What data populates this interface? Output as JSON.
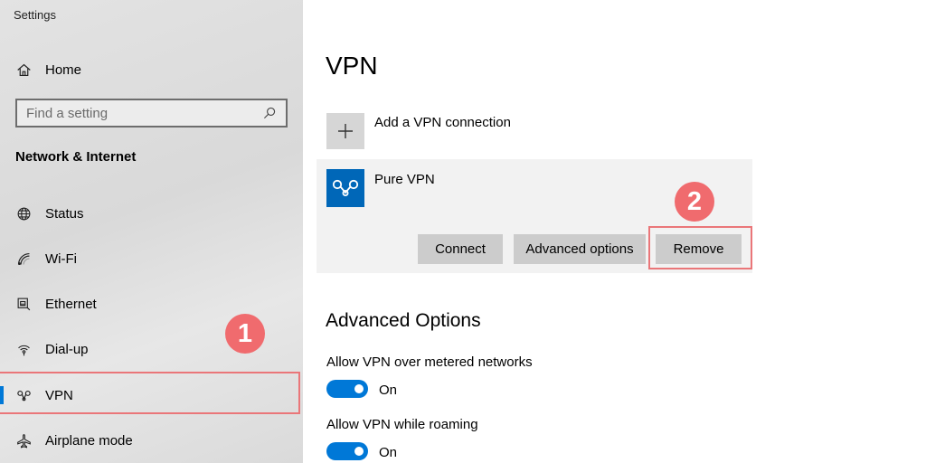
{
  "window": {
    "title": "Settings"
  },
  "sidebar": {
    "home_label": "Home",
    "search": {
      "placeholder": "Find a setting"
    },
    "section_title": "Network & Internet",
    "items": [
      {
        "label": "Status",
        "icon": "globe-icon"
      },
      {
        "label": "Wi-Fi",
        "icon": "wifi-icon"
      },
      {
        "label": "Ethernet",
        "icon": "ethernet-icon"
      },
      {
        "label": "Dial-up",
        "icon": "dial-up-icon"
      },
      {
        "label": "VPN",
        "icon": "vpn-icon",
        "selected": true
      },
      {
        "label": "Airplane mode",
        "icon": "airplane-icon"
      }
    ]
  },
  "main": {
    "title": "VPN",
    "add_connection_label": "Add a VPN connection",
    "connection": {
      "name": "Pure VPN",
      "buttons": {
        "connect": "Connect",
        "advanced": "Advanced options",
        "remove": "Remove"
      }
    },
    "advanced_title": "Advanced Options",
    "settings": [
      {
        "label": "Allow VPN over metered networks",
        "state": "On"
      },
      {
        "label": "Allow VPN while roaming",
        "state": "On"
      }
    ]
  },
  "annotations": {
    "step1": "1",
    "step2": "2"
  },
  "colors": {
    "accent": "#0078d7",
    "highlight": "#ea7679",
    "badge": "#f06b6e",
    "vpn_logo": "#0067b8"
  }
}
